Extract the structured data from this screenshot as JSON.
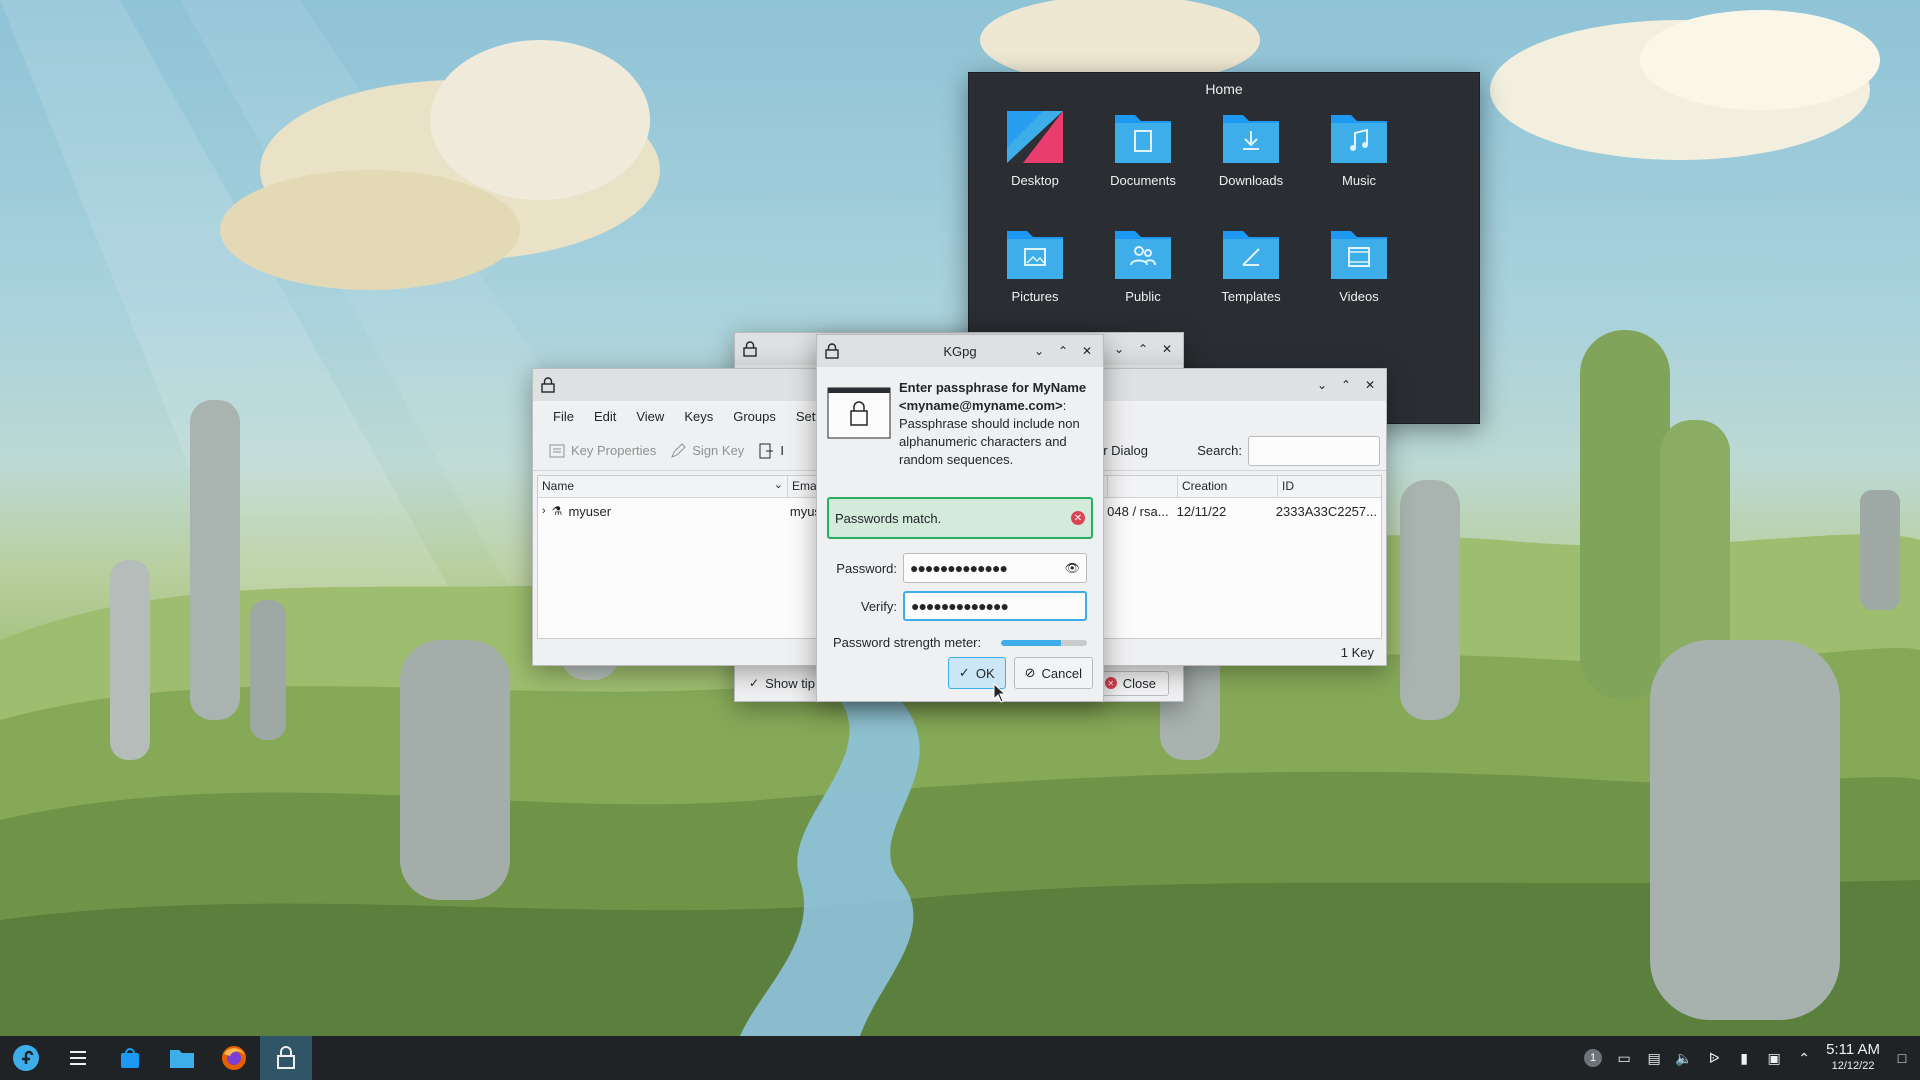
{
  "home_popup": {
    "title": "Home",
    "folders": [
      {
        "label": "Desktop",
        "icon": "desktop-folder-icon"
      },
      {
        "label": "Documents",
        "icon": "documents-folder-icon"
      },
      {
        "label": "Downloads",
        "icon": "downloads-folder-icon"
      },
      {
        "label": "Music",
        "icon": "music-folder-icon"
      },
      {
        "label": "Pictures",
        "icon": "pictures-folder-icon"
      },
      {
        "label": "Public",
        "icon": "public-folder-icon"
      },
      {
        "label": "Templates",
        "icon": "templates-folder-icon"
      },
      {
        "label": "Videos",
        "icon": "videos-folder-icon"
      }
    ]
  },
  "kgpg_main": {
    "menus": [
      "File",
      "Edit",
      "View",
      "Keys",
      "Groups",
      "Setti"
    ],
    "toolbar": {
      "key_properties": "Key Properties",
      "sign_key": "Sign Key",
      "import_partial": "I",
      "server_dialog": "erver Dialog",
      "search_label": "Search:"
    },
    "columns": {
      "name": "Name",
      "email": "Email",
      "size": "",
      "creation": "Creation",
      "id": "ID"
    },
    "rows": [
      {
        "name": "myuser",
        "email": "myus",
        "size": "048 / rsa...",
        "creation": "12/11/22",
        "id": "2333A33C2257..."
      }
    ],
    "status": "1 Key"
  },
  "tip_window": {
    "show_tip_label": "Show tip",
    "close_label": "Close"
  },
  "passphrase_dialog": {
    "title": "KGpg",
    "message_bold": "Enter passphrase for MyName <myname@myname.com>",
    "message_rest": ": Passphrase should include non alphanumeric characters and random sequences.",
    "match_text": "Passwords match.",
    "password_label": "Password:",
    "password_value": "●●●●●●●●●●●●●",
    "verify_label": "Verify:",
    "verify_value": "●●●●●●●●●●●●●",
    "strength_label": "Password strength meter:",
    "strength_fraction": 0.7,
    "ok_label": "OK",
    "cancel_label": "Cancel"
  },
  "taskbar": {
    "clock_time": "5:11 AM",
    "clock_date": "12/12/22",
    "notification_count": "1"
  },
  "colors": {
    "accent": "#3daee9",
    "success": "#27ae60",
    "folder": "#3daee9"
  }
}
